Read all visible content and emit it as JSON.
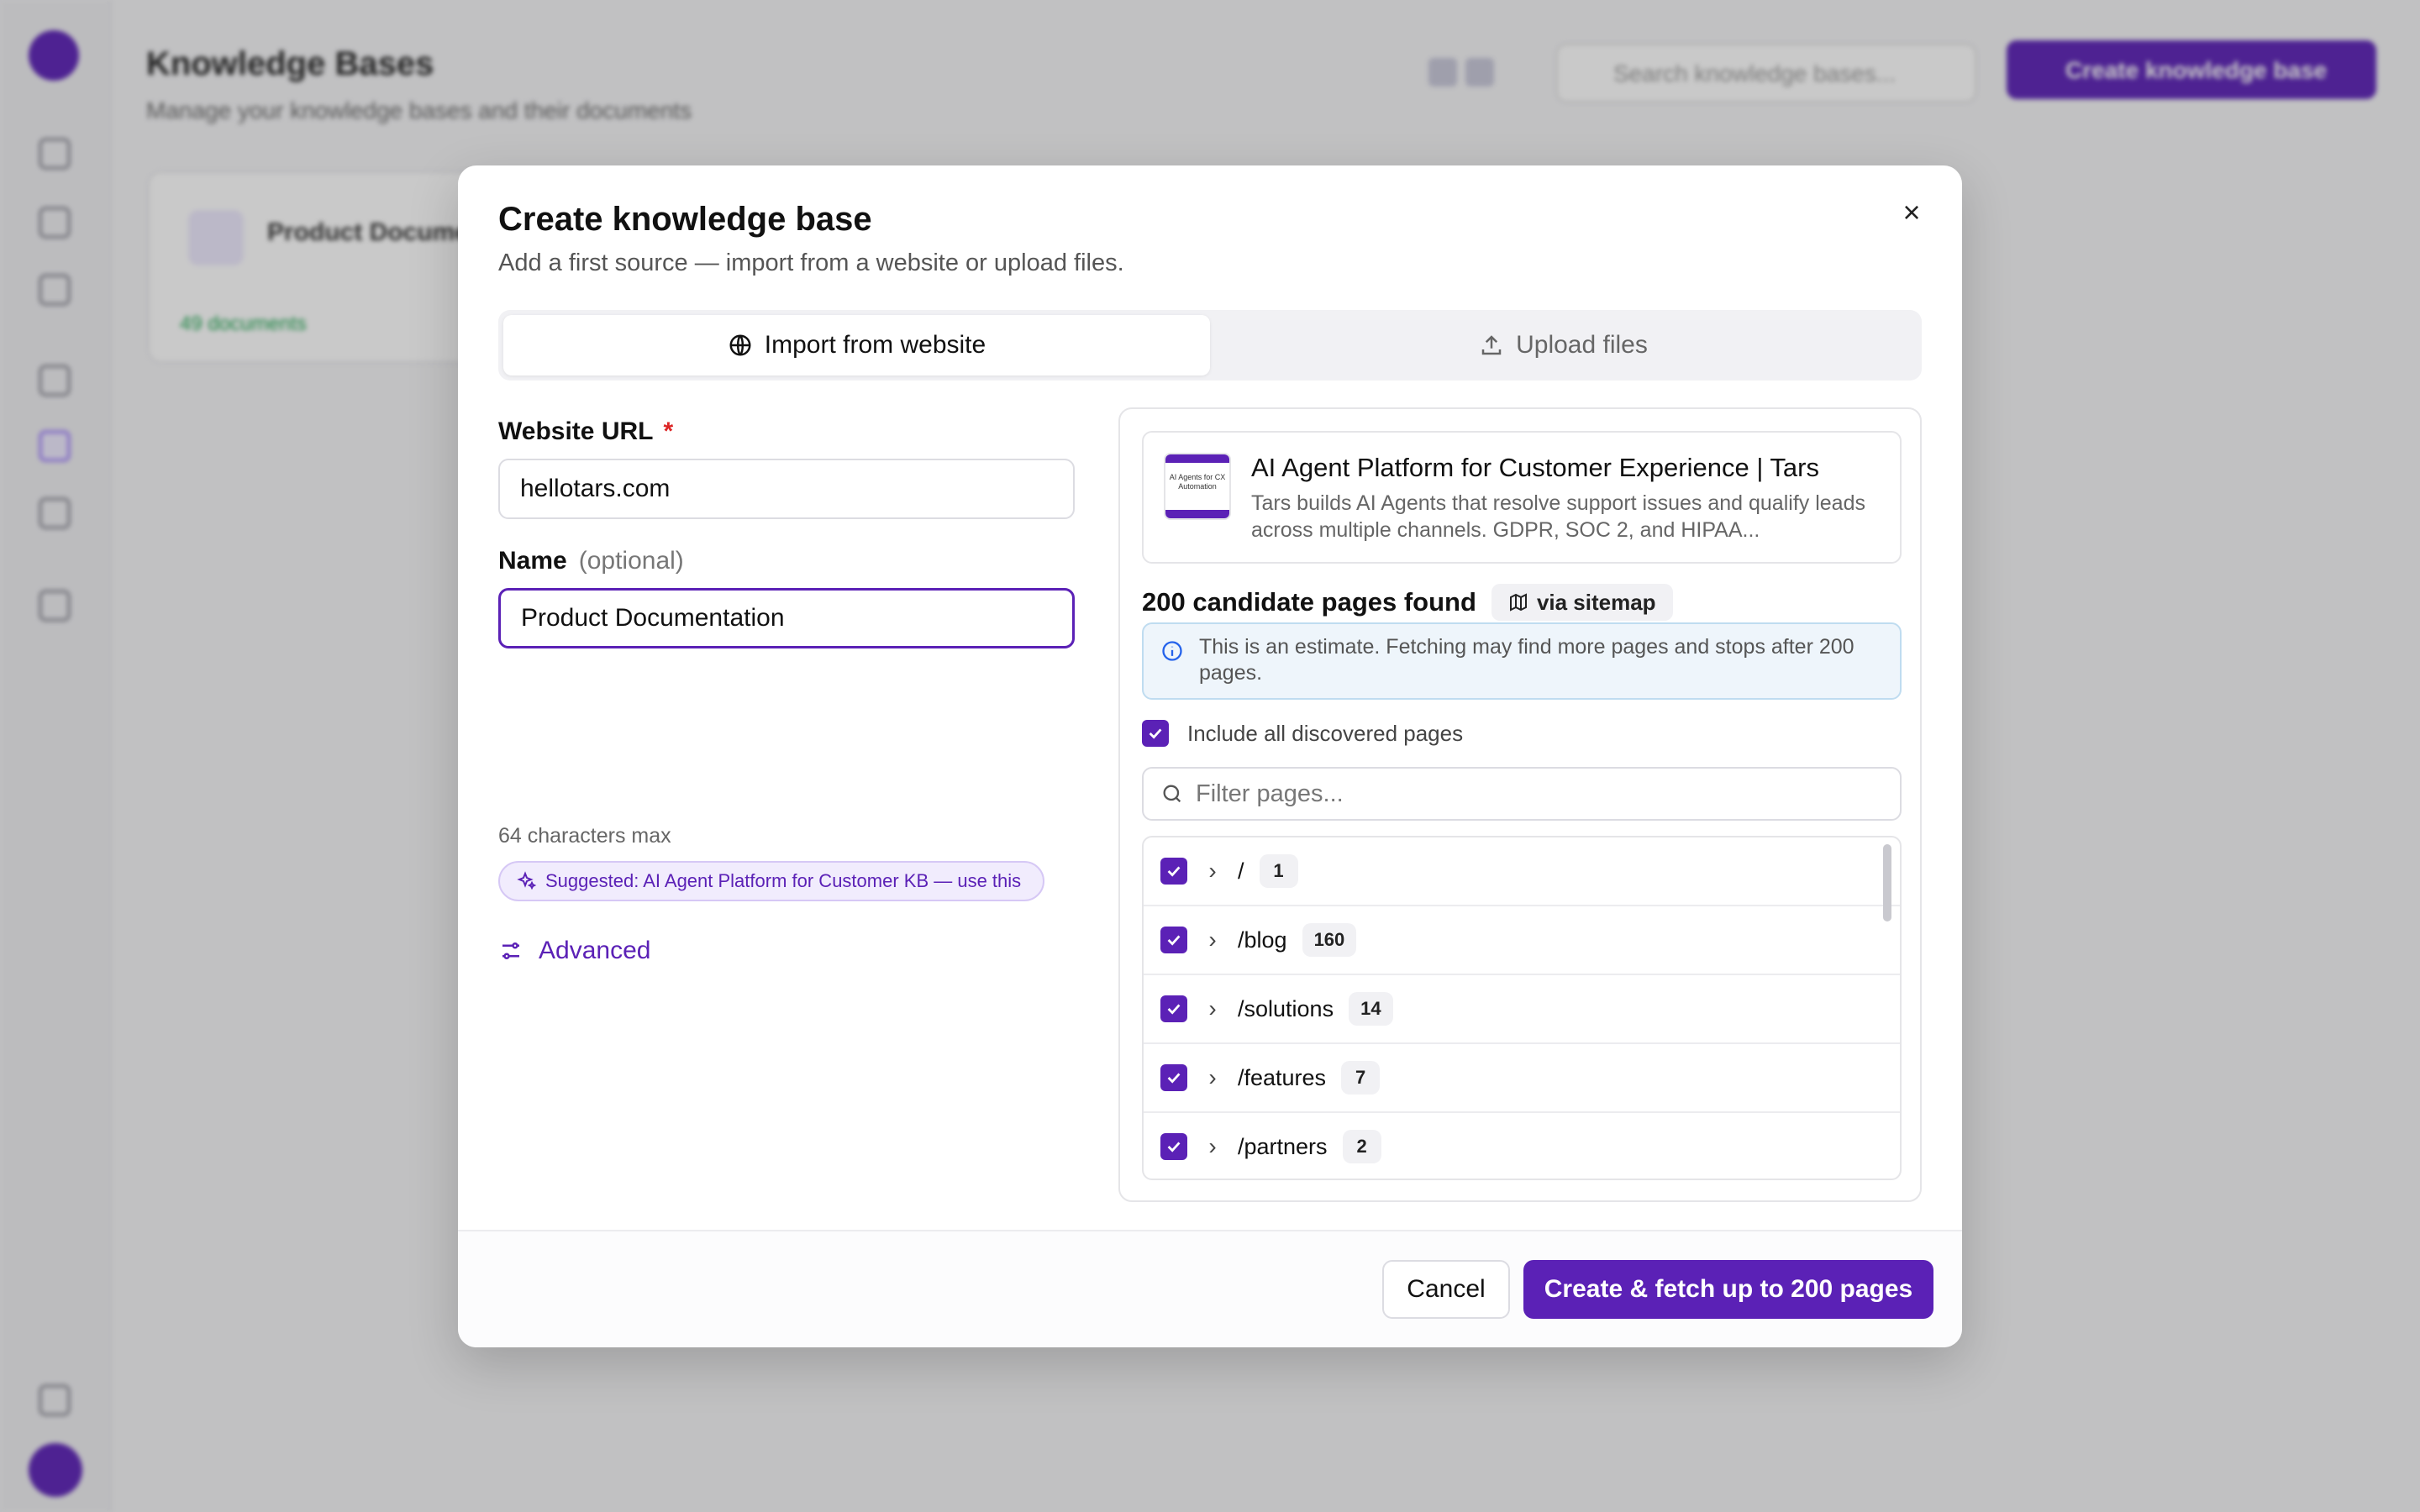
{
  "background": {
    "title": "Knowledge Bases",
    "subtitle": "Manage your knowledge bases and their documents",
    "search_placeholder": "Search knowledge bases...",
    "create_button": "Create knowledge base",
    "card_title": "Product Documentation",
    "card_meta": "49 documents"
  },
  "modal": {
    "title": "Create knowledge base",
    "subtitle": "Add a first source — import from a website or upload files.",
    "close_glyph": "×",
    "tabs": [
      {
        "label": "Import from website",
        "icon": "globe-icon",
        "active": true
      },
      {
        "label": "Upload files",
        "icon": "upload-icon",
        "active": false
      }
    ],
    "url_label": "Website URL",
    "required_mark": "*",
    "url_value": "hellotars.com",
    "name_label": "Name",
    "name_optional": "(optional)",
    "name_value": "Product Documentation",
    "name_hint": "64 characters max",
    "suggestion": "Suggested: AI Agent Platform for Customer KB — use this",
    "advanced_label": "Advanced"
  },
  "preview": {
    "thumb_text": "AI Agents for CX Automation",
    "title": "AI Agent Platform for Customer Experience | Tars",
    "description": "Tars builds AI Agents that resolve support issues and qualify leads across multiple channels. GDPR, SOC 2, and HIPAA..."
  },
  "candidates": {
    "count_label": "200 candidate pages found",
    "source_chip": "via sitemap",
    "info_text": "This is an estimate. Fetching may find more pages and stops after 200 pages.",
    "include_all_label": "Include all discovered pages",
    "include_all_checked": true,
    "filter_placeholder": "Filter pages...",
    "rows": [
      {
        "path": "/",
        "count": "1",
        "checked": true
      },
      {
        "path": "/blog",
        "count": "160",
        "checked": true
      },
      {
        "path": "/solutions",
        "count": "14",
        "checked": true
      },
      {
        "path": "/features",
        "count": "7",
        "checked": true
      },
      {
        "path": "/partners",
        "count": "2",
        "checked": true
      }
    ]
  },
  "footer": {
    "cancel_label": "Cancel",
    "create_label": "Create & fetch up to 200 pages"
  },
  "colors": {
    "accent": "#5b21b6",
    "required": "#dc2626",
    "info_bg": "#eef5fb"
  }
}
